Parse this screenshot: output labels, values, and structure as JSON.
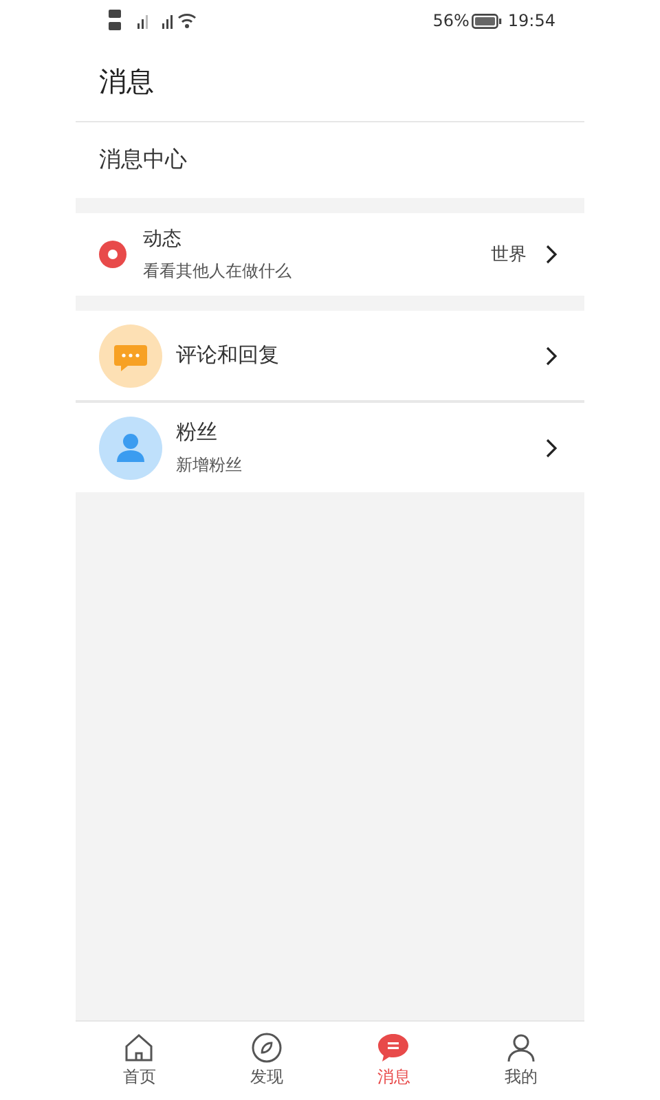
{
  "status_bar": {
    "battery": "56%",
    "time": "19:54"
  },
  "header": {
    "title": "消息"
  },
  "section_title": "消息中心",
  "groups": [
    [
      {
        "kind": "dot",
        "title": "动态",
        "subtitle": "看看其他人在做什么",
        "trailing": "世界"
      }
    ],
    [
      {
        "kind": "comment",
        "title": "评论和回复"
      },
      {
        "kind": "fan",
        "title": "粉丝",
        "subtitle": "新增粉丝"
      }
    ]
  ],
  "nav": [
    {
      "kind": "home",
      "label": "首页",
      "selected": false
    },
    {
      "kind": "discover",
      "label": "发现",
      "selected": false
    },
    {
      "kind": "message",
      "label": "消息",
      "selected": true
    },
    {
      "kind": "me",
      "label": "我的",
      "selected": false
    }
  ]
}
